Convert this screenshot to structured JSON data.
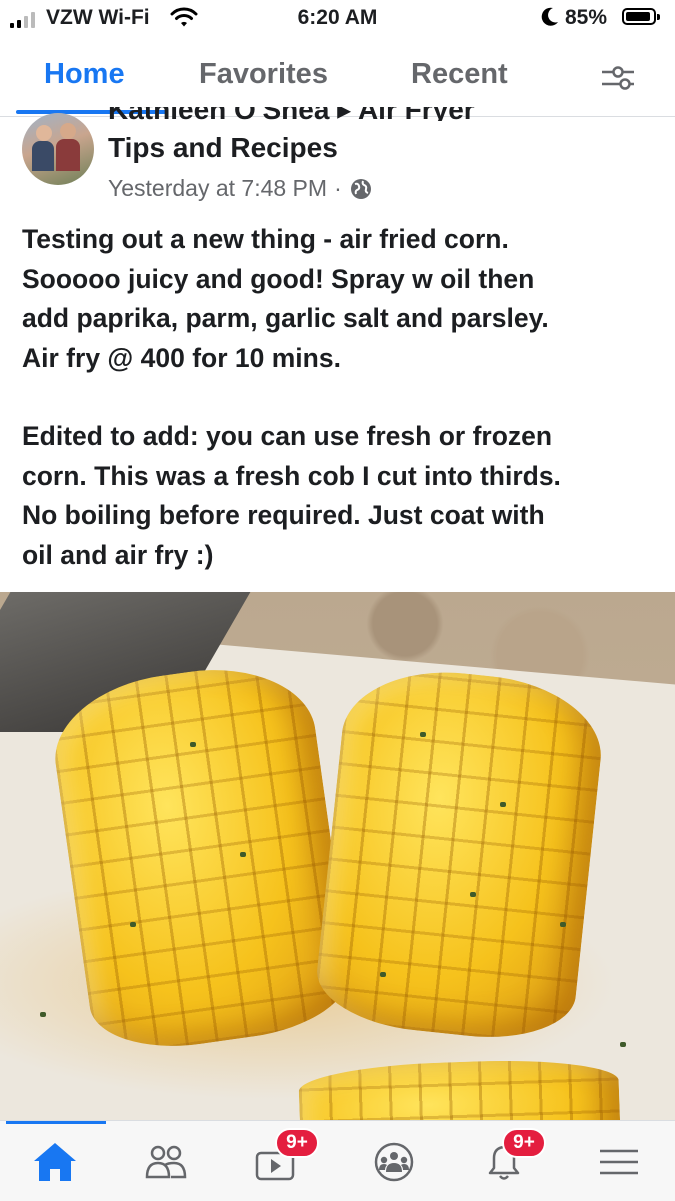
{
  "status_bar": {
    "carrier": "VZW Wi-Fi",
    "time": "6:20 AM",
    "battery": "85%",
    "battery_level": 0.85
  },
  "top_tabs": [
    {
      "label": "Home",
      "active": true
    },
    {
      "label": "Favorites",
      "active": false
    },
    {
      "label": "Recent",
      "active": false
    }
  ],
  "post": {
    "cut_off_header": "Kathleen O'Shea ▸ Air Fryer",
    "group_name": "Tips and Recipes",
    "timestamp": "Yesterday at 7:48 PM",
    "separator": "·",
    "paragraphs": [
      "Testing out a new thing - air fried corn.\nSooooo juicy and good! Spray w oil then\nadd paprika, parm, garlic salt and parsley.\nAir fry @ 400 for 10 mins.",
      "Edited to add: you can use fresh or frozen\ncorn. This was a fresh cob I cut into thirds.\nNo boiling before required. Just coat with\noil and air fry :)"
    ]
  },
  "bottom_nav": {
    "items": [
      {
        "icon": "home-icon",
        "active": true
      },
      {
        "icon": "friends-icon"
      },
      {
        "icon": "watch-icon",
        "badge": "9+"
      },
      {
        "icon": "groups-icon"
      },
      {
        "icon": "bell-icon",
        "badge": "9+"
      },
      {
        "icon": "menu-icon"
      }
    ]
  },
  "colors": {
    "accent": "#1877f2",
    "badge": "#e41e3f",
    "text": "#1c1e21",
    "secondary_text": "#65676b"
  }
}
